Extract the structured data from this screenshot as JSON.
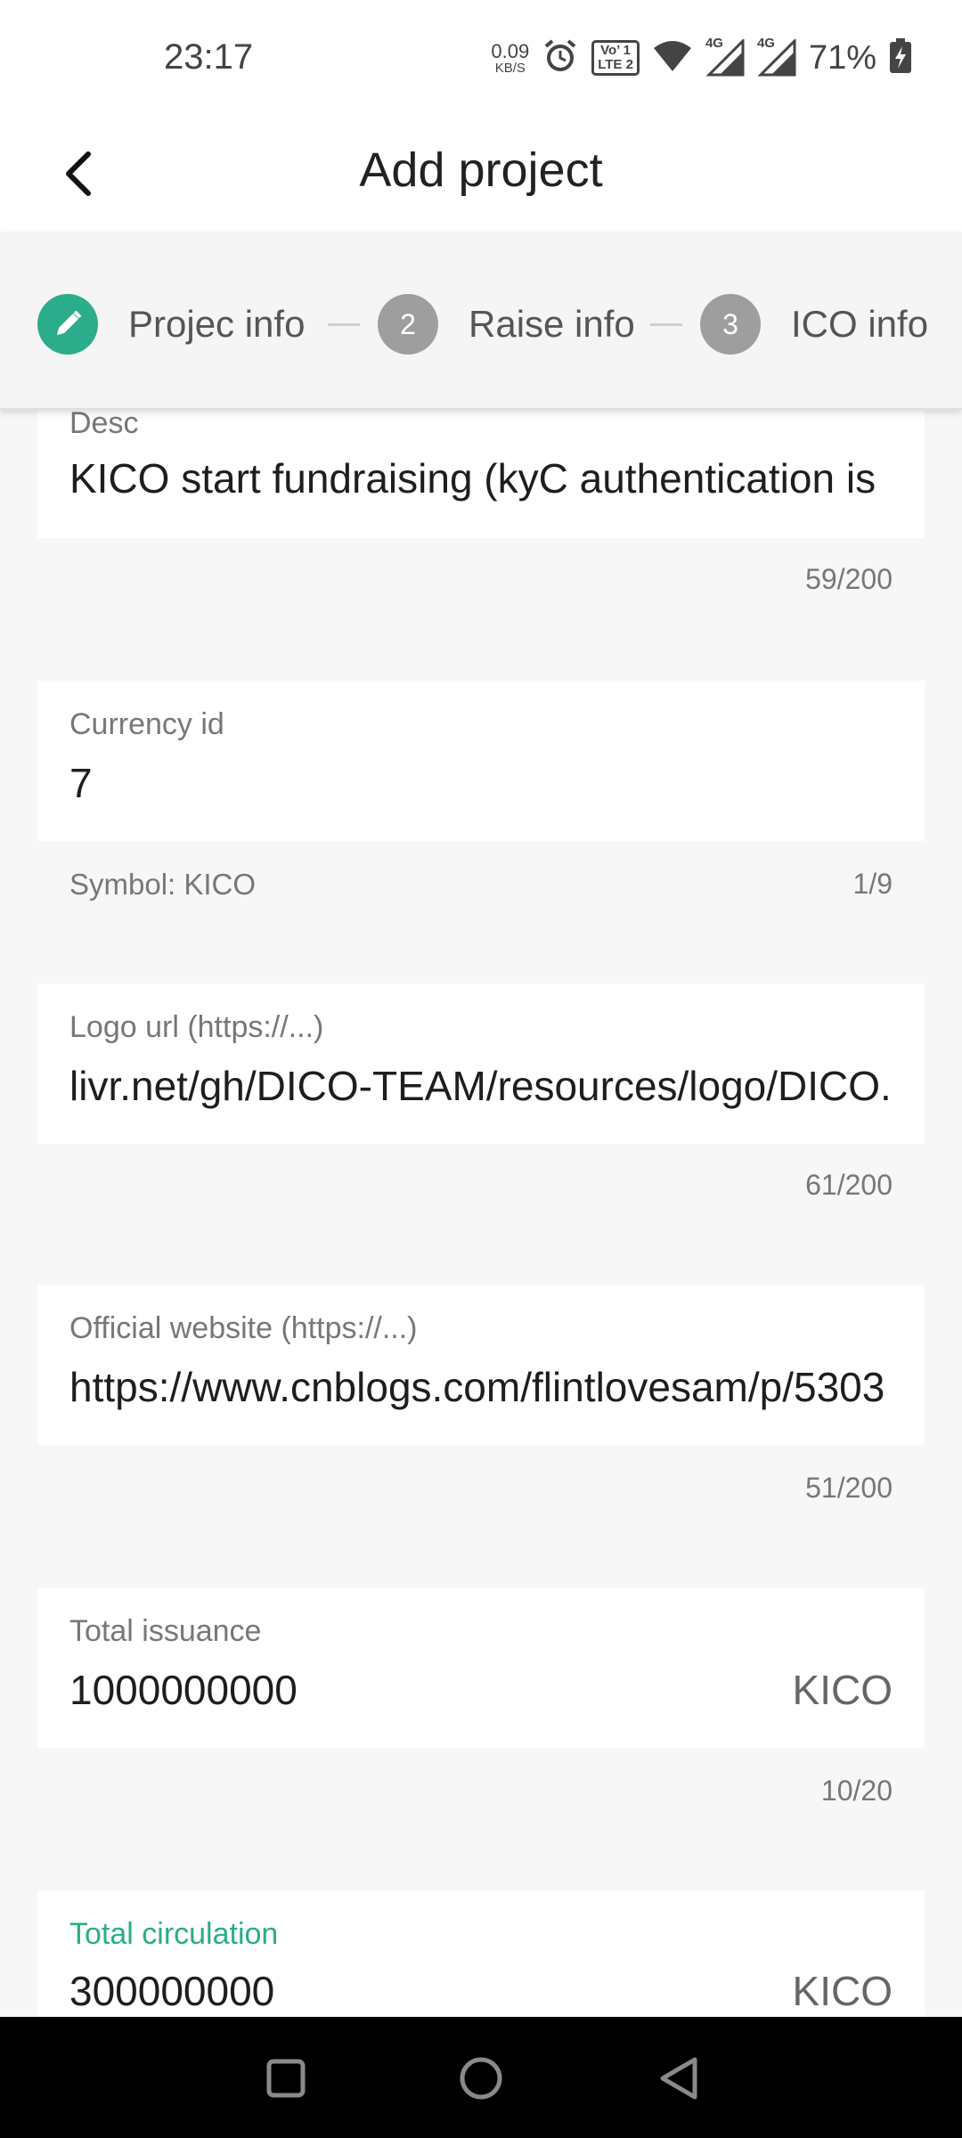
{
  "status_bar": {
    "time": "23:17",
    "net_speed_value": "0.09",
    "net_speed_unit": "KB/S",
    "volte_top": "Vo’ 1",
    "volte_bottom": "LTE 2",
    "signal1_label": "4G",
    "signal2_label": "4G",
    "battery": "71%"
  },
  "header": {
    "title": "Add project",
    "back_icon": "chevron-left-icon"
  },
  "stepper": {
    "steps": [
      {
        "label": "Projec info",
        "icon": "pencil-icon",
        "state": "done"
      },
      {
        "number": "2",
        "label": "Raise info",
        "state": "pending"
      },
      {
        "number": "3",
        "label": "ICO info",
        "state": "pending"
      }
    ]
  },
  "form": {
    "desc": {
      "label": "Desc",
      "value": "KICO start fundraising (kyC authentication is",
      "counter": "59/200"
    },
    "currency_id": {
      "label": "Currency id",
      "value": "7",
      "helper": "Symbol: KICO",
      "counter": "1/9"
    },
    "logo_url": {
      "label": "Logo url (https://...)",
      "value": "livr.net/gh/DICO-TEAM/resources/logo/DICO.png",
      "counter": "61/200"
    },
    "official_website": {
      "label": "Official website (https://...)",
      "value": "https://www.cnblogs.com/flintlovesam/p/5303",
      "counter": "51/200"
    },
    "total_issuance": {
      "label": "Total issuance",
      "value": "1000000000",
      "suffix": "KICO",
      "counter": "10/20"
    },
    "total_circulation": {
      "label": "Total circulation",
      "value": "300000000",
      "suffix": "KICO"
    }
  },
  "colors": {
    "accent": "#2bac8a",
    "pending_step": "#9e9e9e",
    "background": "#f7f7f7",
    "nav_bar": "#000000"
  },
  "nav": {
    "recents_icon": "square-icon",
    "home_icon": "circle-icon",
    "back_icon": "triangle-back-icon"
  }
}
